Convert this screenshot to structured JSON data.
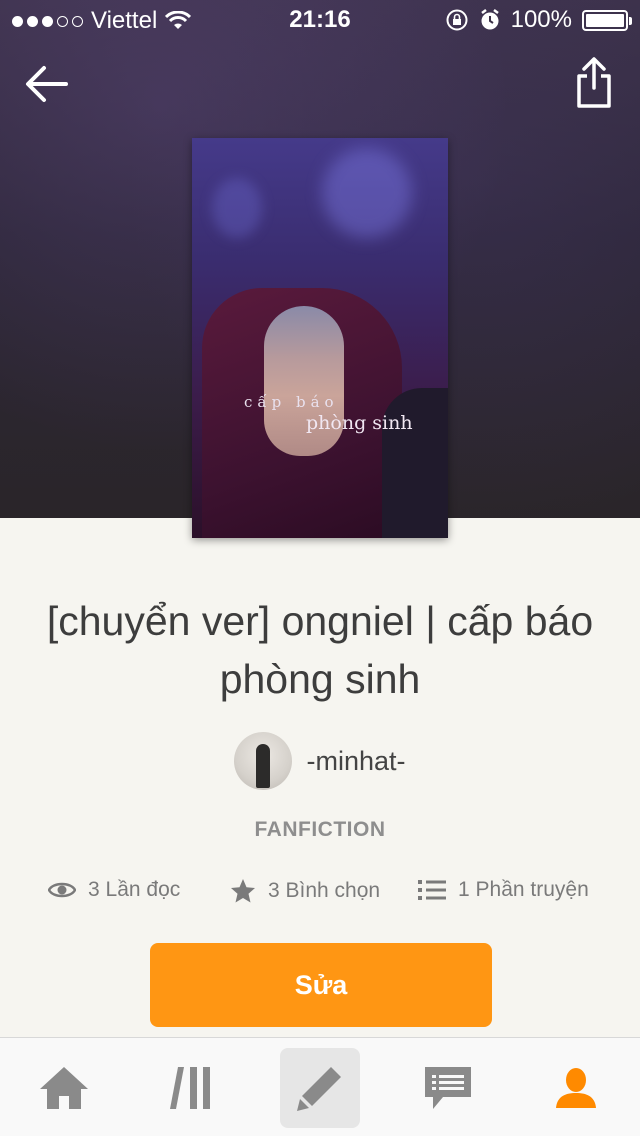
{
  "status_bar": {
    "carrier": "Viettel",
    "time": "21:16",
    "battery": "100%",
    "signal_bars_filled": 3,
    "signal_bars_total": 5
  },
  "header": {
    "back_icon": "arrow-left-icon",
    "share_icon": "share-icon"
  },
  "cover": {
    "line1": "cấp báo",
    "line2": "phòng sinh"
  },
  "story": {
    "title": "[chuyển ver] ongniel | cấp báo phòng sinh",
    "author": "-minhat-",
    "category": "FANFICTION"
  },
  "stats": {
    "reads": "3 Lần đọc",
    "votes": "3 Bình chọn",
    "parts": "1 Phần truyện"
  },
  "actions": {
    "edit_label": "Sửa"
  },
  "tabbar": {
    "items": [
      {
        "icon": "home-icon",
        "active": false
      },
      {
        "icon": "library-icon",
        "active": false
      },
      {
        "icon": "pencil-icon",
        "active": false,
        "highlighted": true
      },
      {
        "icon": "messages-icon",
        "active": false
      },
      {
        "icon": "profile-icon",
        "active": true
      }
    ]
  },
  "colors": {
    "accent": "#ff9613",
    "inactive_icon": "#8a8a8a",
    "page_background": "#f6f5f0"
  }
}
